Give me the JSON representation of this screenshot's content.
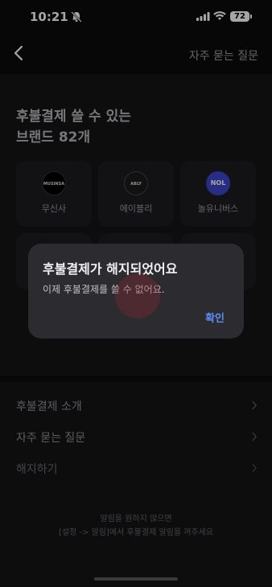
{
  "status_bar": {
    "time": "10:21",
    "battery": "72"
  },
  "nav": {
    "faq_link": "자주 묻는 질문"
  },
  "headline": {
    "line1": "후불결제 쓸 수 있는",
    "line2": "브랜드 82개"
  },
  "brands": [
    {
      "name": "무신사",
      "logo_text": "MUSINSA",
      "logo_color": "#000000"
    },
    {
      "name": "에이블리",
      "logo_text": "ABLY",
      "logo_color": "#1b1b1b"
    },
    {
      "name": "놀유니버스",
      "logo_text": "NOL",
      "logo_color": "#3b46c9"
    }
  ],
  "menu": {
    "intro": "후불결제 소개",
    "faq": "자주 묻는 질문",
    "cancel": "해지하기"
  },
  "footer": {
    "line1": "알림을 원하지 않으면",
    "line2": "[설정 -> 알림]에서 후불결제 알림을 꺼주세요"
  },
  "modal": {
    "title": "후불결제가 해지되었어요",
    "message": "이제 후불결제를 쓸 수 없어요.",
    "confirm": "확인"
  }
}
